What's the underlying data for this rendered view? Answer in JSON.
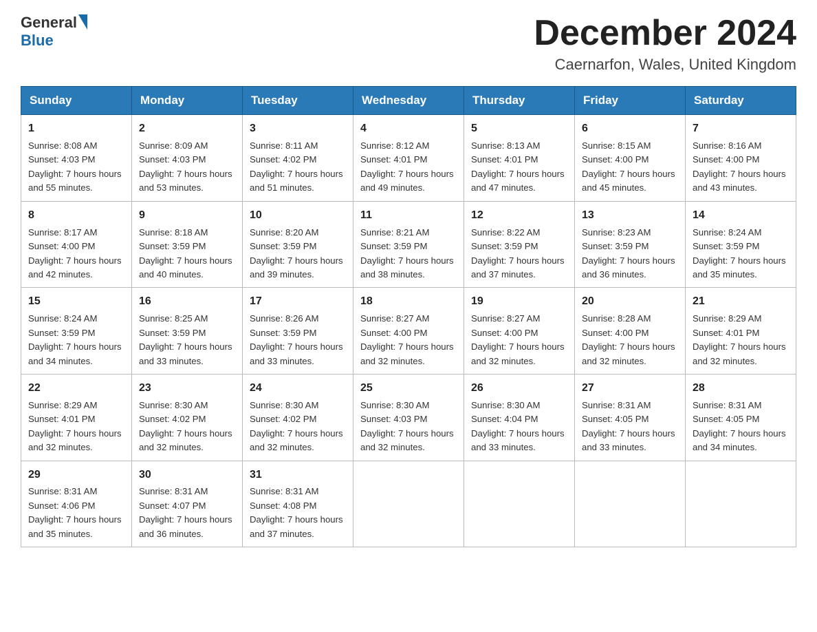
{
  "header": {
    "logo_general": "General",
    "logo_blue": "Blue",
    "month_title": "December 2024",
    "location": "Caernarfon, Wales, United Kingdom"
  },
  "weekdays": [
    "Sunday",
    "Monday",
    "Tuesday",
    "Wednesday",
    "Thursday",
    "Friday",
    "Saturday"
  ],
  "weeks": [
    [
      {
        "day": "1",
        "sunrise": "8:08 AM",
        "sunset": "4:03 PM",
        "daylight": "7 hours and 55 minutes."
      },
      {
        "day": "2",
        "sunrise": "8:09 AM",
        "sunset": "4:03 PM",
        "daylight": "7 hours and 53 minutes."
      },
      {
        "day": "3",
        "sunrise": "8:11 AM",
        "sunset": "4:02 PM",
        "daylight": "7 hours and 51 minutes."
      },
      {
        "day": "4",
        "sunrise": "8:12 AM",
        "sunset": "4:01 PM",
        "daylight": "7 hours and 49 minutes."
      },
      {
        "day": "5",
        "sunrise": "8:13 AM",
        "sunset": "4:01 PM",
        "daylight": "7 hours and 47 minutes."
      },
      {
        "day": "6",
        "sunrise": "8:15 AM",
        "sunset": "4:00 PM",
        "daylight": "7 hours and 45 minutes."
      },
      {
        "day": "7",
        "sunrise": "8:16 AM",
        "sunset": "4:00 PM",
        "daylight": "7 hours and 43 minutes."
      }
    ],
    [
      {
        "day": "8",
        "sunrise": "8:17 AM",
        "sunset": "4:00 PM",
        "daylight": "7 hours and 42 minutes."
      },
      {
        "day": "9",
        "sunrise": "8:18 AM",
        "sunset": "3:59 PM",
        "daylight": "7 hours and 40 minutes."
      },
      {
        "day": "10",
        "sunrise": "8:20 AM",
        "sunset": "3:59 PM",
        "daylight": "7 hours and 39 minutes."
      },
      {
        "day": "11",
        "sunrise": "8:21 AM",
        "sunset": "3:59 PM",
        "daylight": "7 hours and 38 minutes."
      },
      {
        "day": "12",
        "sunrise": "8:22 AM",
        "sunset": "3:59 PM",
        "daylight": "7 hours and 37 minutes."
      },
      {
        "day": "13",
        "sunrise": "8:23 AM",
        "sunset": "3:59 PM",
        "daylight": "7 hours and 36 minutes."
      },
      {
        "day": "14",
        "sunrise": "8:24 AM",
        "sunset": "3:59 PM",
        "daylight": "7 hours and 35 minutes."
      }
    ],
    [
      {
        "day": "15",
        "sunrise": "8:24 AM",
        "sunset": "3:59 PM",
        "daylight": "7 hours and 34 minutes."
      },
      {
        "day": "16",
        "sunrise": "8:25 AM",
        "sunset": "3:59 PM",
        "daylight": "7 hours and 33 minutes."
      },
      {
        "day": "17",
        "sunrise": "8:26 AM",
        "sunset": "3:59 PM",
        "daylight": "7 hours and 33 minutes."
      },
      {
        "day": "18",
        "sunrise": "8:27 AM",
        "sunset": "4:00 PM",
        "daylight": "7 hours and 32 minutes."
      },
      {
        "day": "19",
        "sunrise": "8:27 AM",
        "sunset": "4:00 PM",
        "daylight": "7 hours and 32 minutes."
      },
      {
        "day": "20",
        "sunrise": "8:28 AM",
        "sunset": "4:00 PM",
        "daylight": "7 hours and 32 minutes."
      },
      {
        "day": "21",
        "sunrise": "8:29 AM",
        "sunset": "4:01 PM",
        "daylight": "7 hours and 32 minutes."
      }
    ],
    [
      {
        "day": "22",
        "sunrise": "8:29 AM",
        "sunset": "4:01 PM",
        "daylight": "7 hours and 32 minutes."
      },
      {
        "day": "23",
        "sunrise": "8:30 AM",
        "sunset": "4:02 PM",
        "daylight": "7 hours and 32 minutes."
      },
      {
        "day": "24",
        "sunrise": "8:30 AM",
        "sunset": "4:02 PM",
        "daylight": "7 hours and 32 minutes."
      },
      {
        "day": "25",
        "sunrise": "8:30 AM",
        "sunset": "4:03 PM",
        "daylight": "7 hours and 32 minutes."
      },
      {
        "day": "26",
        "sunrise": "8:30 AM",
        "sunset": "4:04 PM",
        "daylight": "7 hours and 33 minutes."
      },
      {
        "day": "27",
        "sunrise": "8:31 AM",
        "sunset": "4:05 PM",
        "daylight": "7 hours and 33 minutes."
      },
      {
        "day": "28",
        "sunrise": "8:31 AM",
        "sunset": "4:05 PM",
        "daylight": "7 hours and 34 minutes."
      }
    ],
    [
      {
        "day": "29",
        "sunrise": "8:31 AM",
        "sunset": "4:06 PM",
        "daylight": "7 hours and 35 minutes."
      },
      {
        "day": "30",
        "sunrise": "8:31 AM",
        "sunset": "4:07 PM",
        "daylight": "7 hours and 36 minutes."
      },
      {
        "day": "31",
        "sunrise": "8:31 AM",
        "sunset": "4:08 PM",
        "daylight": "7 hours and 37 minutes."
      },
      null,
      null,
      null,
      null
    ]
  ]
}
